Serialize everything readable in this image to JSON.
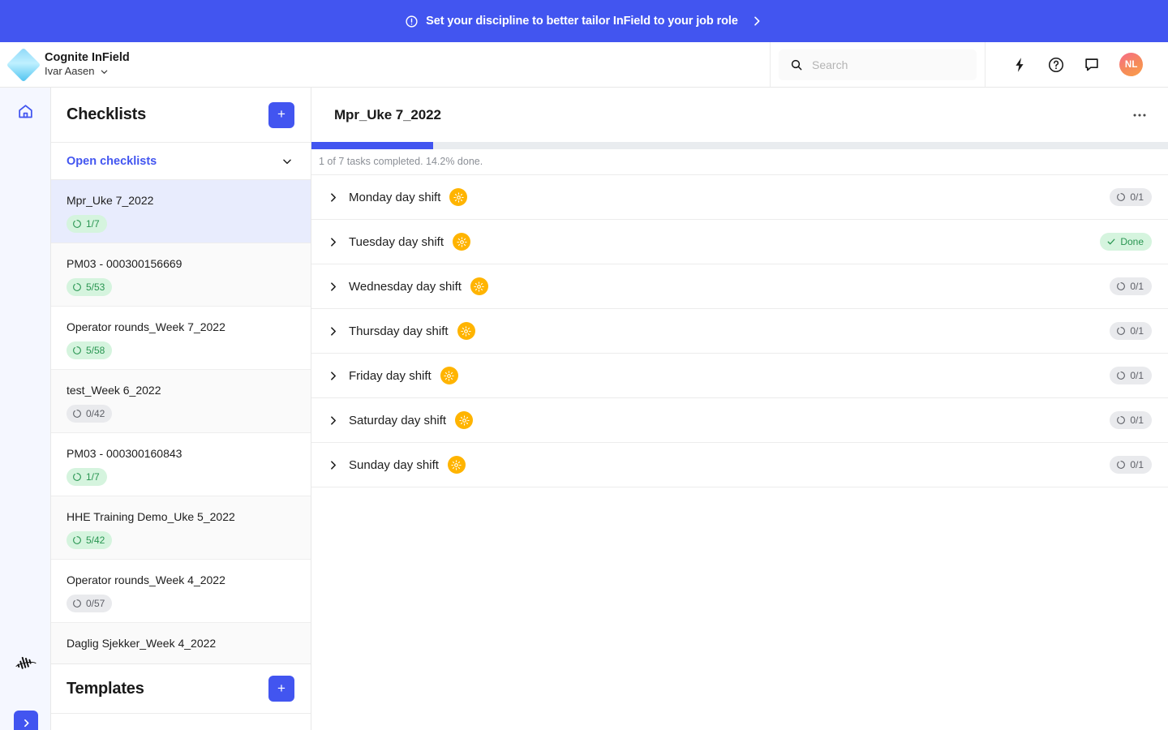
{
  "banner": {
    "icon": "info-circle-icon",
    "text": "Set your discipline to better tailor InField to your job role",
    "chevron": "chevron-right-icon"
  },
  "header": {
    "logo": "cognite-diamond-logo",
    "app_title": "Cognite InField",
    "project_name": "Ivar Aasen",
    "project_chevron": "chevron-down-icon",
    "search": {
      "icon": "search-icon",
      "placeholder": "Search",
      "value": ""
    },
    "actions": [
      {
        "name": "quick-actions-icon",
        "label": "lightning-bolt-icon"
      },
      {
        "name": "help-icon",
        "label": "question-circle-icon"
      },
      {
        "name": "feedback-icon",
        "label": "chat-bubble-icon"
      }
    ],
    "avatar_initials": "NL"
  },
  "rail": {
    "home_icon": "home-icon",
    "logo_icon": "cognite-mark-icon",
    "expand_icon": "chevron-right-icon"
  },
  "sidebar": {
    "title": "Checklists",
    "add_label": "+",
    "group": {
      "label": "Open checklists",
      "chevron": "chevron-down-icon"
    },
    "items": [
      {
        "name": "Mpr_Uke 7_2022",
        "progress": "1/7",
        "tone": "green",
        "active": true,
        "stripe": false
      },
      {
        "name": "PM03 - 000300156669",
        "progress": "5/53",
        "tone": "green",
        "active": false,
        "stripe": true
      },
      {
        "name": "Operator rounds_Week 7_2022",
        "progress": "5/58",
        "tone": "green",
        "active": false,
        "stripe": false
      },
      {
        "name": "test_Week 6_2022",
        "progress": "0/42",
        "tone": "gray",
        "active": false,
        "stripe": true
      },
      {
        "name": "PM03 - 000300160843",
        "progress": "1/7",
        "tone": "green",
        "active": false,
        "stripe": false
      },
      {
        "name": "HHE Training Demo_Uke 5_2022",
        "progress": "5/42",
        "tone": "green",
        "active": false,
        "stripe": true
      },
      {
        "name": "Operator rounds_Week 4_2022",
        "progress": "0/57",
        "tone": "gray",
        "active": false,
        "stripe": false
      },
      {
        "name": "Daglig Sjekker_Week 4_2022",
        "progress": "",
        "tone": "gray",
        "active": false,
        "stripe": true
      }
    ],
    "templates": {
      "title": "Templates",
      "add_label": "+"
    }
  },
  "main": {
    "title": "Mpr_Uke 7_2022",
    "menu_icon": "ellipsis-icon",
    "progress": {
      "percent": 14.2,
      "text": "1 of 7 tasks completed. 14.2% done."
    },
    "tasks": [
      {
        "label": "Monday day shift",
        "shift_icon": "sun-icon",
        "status": "0/1",
        "tone": "gray"
      },
      {
        "label": "Tuesday day shift",
        "shift_icon": "sun-icon",
        "status": "Done",
        "tone": "green"
      },
      {
        "label": "Wednesday day shift",
        "shift_icon": "sun-icon",
        "status": "0/1",
        "tone": "gray"
      },
      {
        "label": "Thursday day shift",
        "shift_icon": "sun-icon",
        "status": "0/1",
        "tone": "gray"
      },
      {
        "label": "Friday day shift",
        "shift_icon": "sun-icon",
        "status": "0/1",
        "tone": "gray"
      },
      {
        "label": "Saturday day shift",
        "shift_icon": "sun-icon",
        "status": "0/1",
        "tone": "gray"
      },
      {
        "label": "Sunday day shift",
        "shift_icon": "sun-icon",
        "status": "0/1",
        "tone": "gray"
      }
    ]
  },
  "colors": {
    "brand_blue": "#4255f0",
    "sun_amber": "#ffb400",
    "badge_green_bg": "#d5f4de",
    "badge_green_fg": "#299551",
    "badge_gray_bg": "#e9eaed",
    "badge_gray_fg": "#5d5f66",
    "active_row": "#e8ecfd"
  }
}
